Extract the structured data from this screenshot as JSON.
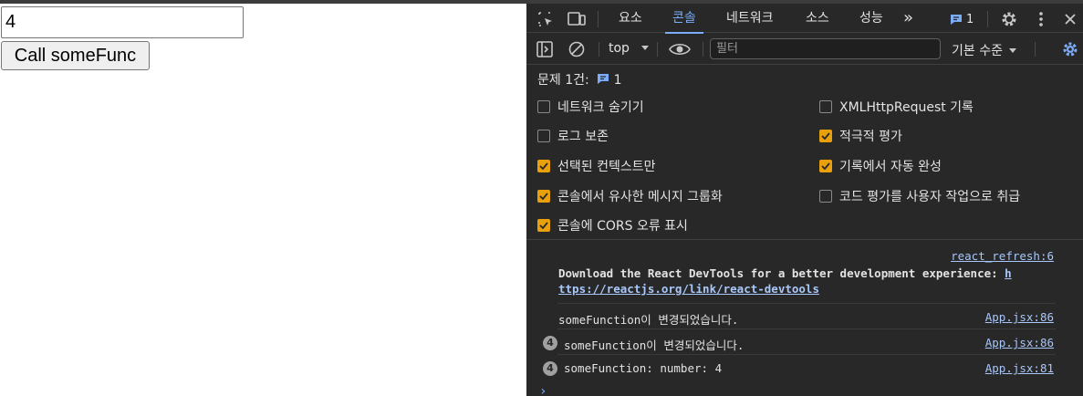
{
  "page": {
    "input_value": "4",
    "button_label": "Call someFunc"
  },
  "devtools": {
    "tabs": [
      "요소",
      "콘솔",
      "네트워크",
      "소스",
      "성능"
    ],
    "active_tab": "콘솔",
    "more_tabs_glyph": "»",
    "issues_badge_count": "1",
    "context": "top",
    "filter_placeholder": "필터",
    "level": "기본 수준",
    "issues_line": "문제 1건:",
    "issues_count": "1",
    "settings_left": [
      {
        "label": "네트워크 숨기기",
        "checked": false
      },
      {
        "label": "로그 보존",
        "checked": false
      },
      {
        "label": "선택된 컨텍스트만",
        "checked": true
      },
      {
        "label": "콘솔에서 유사한 메시지 그룹화",
        "checked": true
      },
      {
        "label": "콘솔에 CORS 오류 표시",
        "checked": true
      }
    ],
    "settings_right": [
      {
        "label": "XMLHttpRequest 기록",
        "checked": false
      },
      {
        "label": "적극적 평가",
        "checked": true
      },
      {
        "label": "기록에서 자동 완성",
        "checked": true
      },
      {
        "label": "코드 평가를 사용자 작업으로 취급",
        "checked": false
      }
    ],
    "console": {
      "react_source": "react_refresh:6",
      "react_msg_text": "Download the React DevTools for a better development experience: ",
      "react_msg_link_a": "h",
      "react_msg_link_b": "ttps://reactjs.org/link/react-devtools",
      "messages": [
        {
          "count": "",
          "text": "someFunction이 변경되었습니다.",
          "source": "App.jsx:86"
        },
        {
          "count": "4",
          "text": "someFunction이 변경되었습니다.",
          "source": "App.jsx:86"
        },
        {
          "count": "4",
          "text": "someFunction: number: 4",
          "source": "App.jsx:81"
        }
      ],
      "prompt": "›"
    }
  },
  "colors": {
    "devtools_bg": "#282828",
    "accent_blue": "#7cacf8",
    "checkbox_on": "#e8a00c"
  },
  "icons": [
    "inspect-element-icon",
    "device-toolbar-icon",
    "issues-icon",
    "settings-gear-icon",
    "kebab-menu-icon",
    "close-icon",
    "sidebar-toggle-icon",
    "clear-console-icon",
    "eye-live-expression-icon",
    "console-settings-gear-icon",
    "chevron-down-icon"
  ]
}
